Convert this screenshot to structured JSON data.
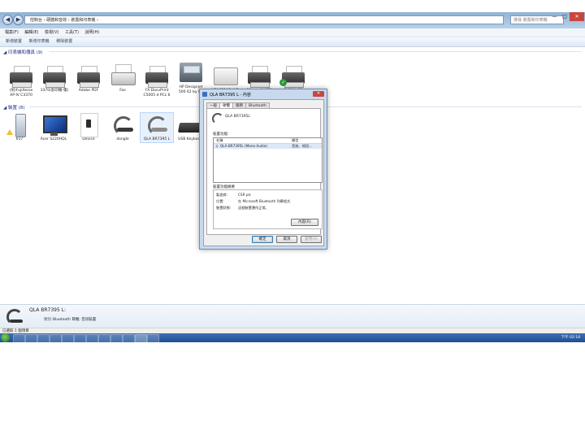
{
  "window": {
    "address": "控制台  ›  硬體和音效  ›  裝置和印表機  ›",
    "search_placeholder": "搜尋 裝置和印表機",
    "controls": {
      "minimize": "—",
      "maximize": "□",
      "close": "✕"
    }
  },
  "menu": [
    "檔案(F)",
    "編輯(E)",
    "檢視(V)",
    "工具(T)",
    "說明(H)"
  ],
  "toolbar": [
    "新增裝置",
    "新增印表機",
    "移除裝置"
  ],
  "printers_group": {
    "title": "印表機和傳真 (9)"
  },
  "printers": [
    {
      "label": "(刑)FujiXerox\nAP-IV C3370"
    },
    {
      "label": "3370(影印機-電)"
    },
    {
      "label": "Adobe PDF"
    },
    {
      "label": "Fax"
    },
    {
      "label": "FX DocuPrint\nC5005 d PCL 6"
    },
    {
      "label": "HP Designjet\n500 42 by HP"
    },
    {
      "label": "HPA4B1AB (HP"
    },
    {
      "label": "Microsoft XPS"
    },
    {
      "label": "RICOH MP"
    }
  ],
  "devices_group": {
    "title": "裝置 (8)"
  },
  "devices": [
    {
      "label": "617"
    },
    {
      "label": "Acer S220HQL"
    },
    {
      "label": "Device"
    },
    {
      "label": "dongle"
    },
    {
      "label": "QLA BR7395 L"
    },
    {
      "label": "USB Keyboard"
    }
  ],
  "dialog": {
    "title": "QLA BR7395 L - 內容",
    "close": "✕",
    "tabs": [
      "一般",
      "硬體",
      "服務",
      "Bluetooth"
    ],
    "device_name": "QLA BR7395L",
    "functions_label": "裝置功能:",
    "columns": [
      "名稱",
      "類型"
    ],
    "rows": [
      {
        "name": "QLA BR7395L (Mono Audio)",
        "type": "音效、視訊..."
      }
    ],
    "summary_label": "裝置功能摘要",
    "props": [
      {
        "k": "製造商:",
        "v": "CSR plc"
      },
      {
        "k": "位置:",
        "v": "在 Microsoft Bluetooth 列舉程式"
      },
      {
        "k": "裝置狀態:",
        "v": "這個裝置運作正常。"
      }
    ],
    "properties_button": "內容(R)",
    "ok_button": "確定",
    "cancel_button": "取消",
    "apply_button": "套用(A)"
  },
  "detail": {
    "name": "QLA BR7395 L:",
    "category_label": "類別:",
    "category_value": "Bluetooth 耳機; 音訊裝置"
  },
  "status": "已選取 1 個項目",
  "taskbar": {
    "clock": "下午 02:18"
  }
}
